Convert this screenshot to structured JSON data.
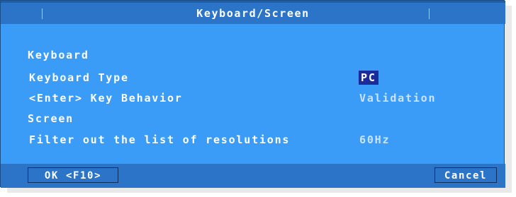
{
  "dialog": {
    "title": "Keyboard/Screen",
    "sections": [
      {
        "heading": "Keyboard",
        "items": [
          {
            "label": "Keyboard Type",
            "value": "PC",
            "selected": true
          },
          {
            "label": "<Enter> Key Behavior",
            "value": "Validation",
            "selected": false
          }
        ]
      },
      {
        "heading": "Screen",
        "items": [
          {
            "label": "Filter out the list of resolutions",
            "value": "60Hz",
            "selected": false
          }
        ]
      }
    ],
    "buttons": {
      "ok": "OK <F10>",
      "cancel": "Cancel"
    }
  },
  "colors": {
    "dialog_bg": "#3a9cf7",
    "titlebar_bg": "#2b74c7",
    "selected_bg": "#1b2b9a",
    "value_text": "#cbe3ff"
  }
}
